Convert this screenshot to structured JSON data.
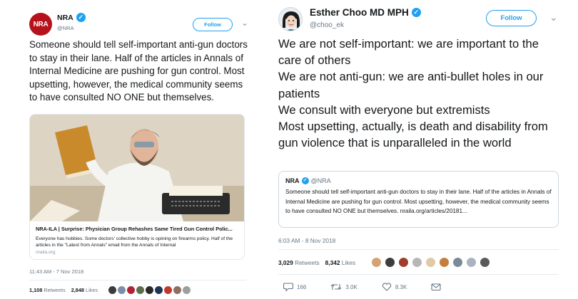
{
  "left_tweet": {
    "avatar_text": "NRA",
    "name": "NRA",
    "handle": "@NRA",
    "follow_label": "Follow",
    "text": "Someone should tell self-important  anti-gun doctors to stay in their lane. Half of the articles in Annals of Internal Medicine are pushing for gun control. Most upsetting, however, the medical community seems to have consulted NO ONE but themselves.",
    "card": {
      "title": "NRA-ILA | Surprise: Physician Group Rehashes Same Tired Gun Control Polic...",
      "description": "Everyone has hobbies. Some doctors' collective hobby is opining on firearms policy. Half of the articles in the \"Latest from Annals\" email from the Annals of Internal",
      "domain": "nraila.org"
    },
    "timestamp": "11:43 AM - 7 Nov 2018",
    "retweets_count": "1,108",
    "retweets_label": "Retweets",
    "likes_count": "2,848",
    "likes_label": "Likes"
  },
  "right_tweet": {
    "name": "Esther Choo MD MPH",
    "handle": "@choo_ek",
    "follow_label": "Follow",
    "text": "We are not self-important: we are important to the care of others\nWe are not anti-gun: we are anti-bullet holes in our patients\nWe consult with everyone but extremists\nMost upsetting, actually, is death and disability from gun violence that is unparalleled in the world",
    "quote": {
      "name": "NRA",
      "handle": "@NRA",
      "text": "Someone should tell self-important  anti-gun doctors to stay in their lane. Half of the articles in Annals of Internal Medicine are pushing for gun control. Most upsetting, however, the medical community seems to have consulted NO ONE but themselves.",
      "link": "nraila.org/articles/20181..."
    },
    "timestamp": "6:03 AM - 8 Nov 2018",
    "retweets_count": "3,029",
    "retweets_label": "Retweets",
    "likes_count": "8,342",
    "likes_label": "Likes",
    "reply_count": "166",
    "retweet_action_count": "3.0K",
    "like_action_count": "8.3K"
  },
  "colors": {
    "twitter_blue": "#1da1f2",
    "nra_red": "#b5121b",
    "secondary_text": "#657786"
  }
}
